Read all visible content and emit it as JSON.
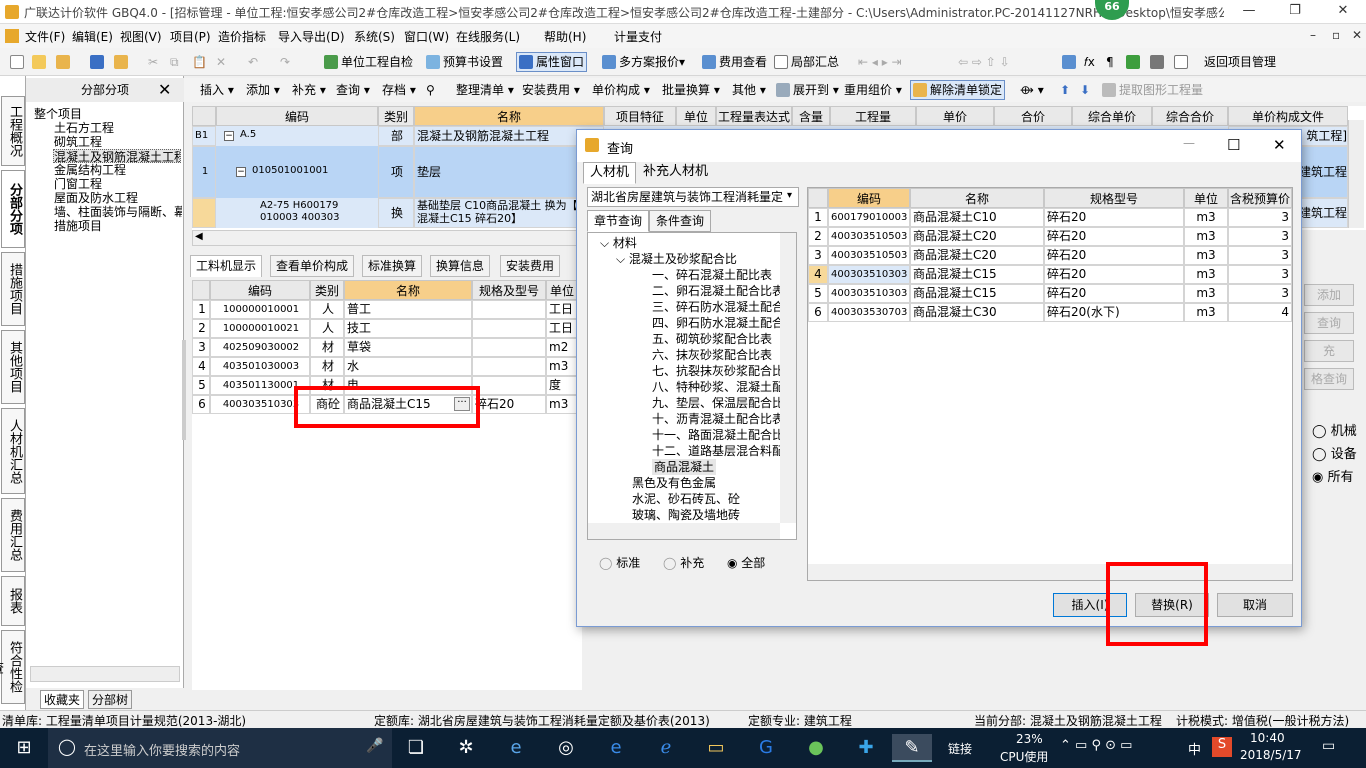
{
  "titlebar": {
    "title": "广联达计价软件 GBQ4.0 - [招标管理 - 单位工程:恒安孝感公司2#仓库改造工程>恒安孝感公司2#仓库改造工程>恒安孝感公司2#仓库改造工程-土建部分 - C:\\Users\\Administrator.PC-20141127NRHM\\Desktop\\恒安孝感公...",
    "badge": "66"
  },
  "menu": [
    "文件(F)",
    "编辑(E)",
    "视图(V)",
    "项目(P)",
    "造价指标",
    "导入导出(D)",
    "系统(S)",
    "窗口(W)",
    "在线服务(L)",
    "帮助(H)",
    "计量支付"
  ],
  "toolbar1": {
    "self_check": "单位工程自检",
    "budget_settings": "预算书设置",
    "property_window": "属性窗口",
    "multi_plan": "多方案报价",
    "fee_view": "费用查看",
    "local_summary": "局部汇总",
    "back_to_project": "返回项目管理"
  },
  "lefttabs": [
    "工程概况",
    "分部分项",
    "措施项目",
    "其他项目",
    "人材机汇总",
    "费用汇总",
    "报表",
    "符合性检查"
  ],
  "tree": {
    "header": "分部分项",
    "root": "整个项目",
    "items": [
      "土石方工程",
      "砌筑工程",
      "混凝土及钢筋混凝土工程",
      "金属结构工程",
      "门窗工程",
      "屋面及防水工程",
      "墙、柱面装饰与隔断、幕",
      "措施项目"
    ],
    "bottom_tabs": [
      "收藏夹",
      "分部树"
    ]
  },
  "toolbar2": [
    "插入",
    "添加",
    "补充",
    "查询",
    "存档",
    "整理清单",
    "安装费用",
    "单价构成",
    "批量换算",
    "其他",
    "展开到",
    "重用组价",
    "解除清单锁定",
    "提取图形工程量"
  ],
  "main_table": {
    "headers": [
      "编码",
      "类别",
      "名称",
      "项目特征",
      "单位",
      "工程量表达式",
      "含量",
      "工程量",
      "单价",
      "合价",
      "综合单价",
      "综合合价",
      "单价构成文件"
    ],
    "rows": [
      {
        "num": "B1",
        "code": "A.5",
        "type": "部",
        "name": "混凝土及钢筋混凝土工程",
        "last": "筑工程]"
      },
      {
        "num": "1",
        "code": "010501001001",
        "type": "项",
        "name": "垫层",
        "last": "建筑工程"
      },
      {
        "num": "",
        "code": "A2-75 H600179 010003 400303",
        "type": "换",
        "name": "基础垫层 C10商品混凝土  换为【商品混凝土C15 碎石20】",
        "last": "建筑工程"
      }
    ]
  },
  "subtabs": [
    "工料机显示",
    "查看单价构成",
    "标准换算",
    "换算信息",
    "安装费用"
  ],
  "sub_table": {
    "headers": [
      "编码",
      "类别",
      "名称",
      "规格及型号",
      "单位"
    ],
    "rows": [
      {
        "num": "1",
        "code": "100000010001",
        "type": "人",
        "name": "普工",
        "spec": "",
        "unit": "工日"
      },
      {
        "num": "2",
        "code": "100000010021",
        "type": "人",
        "name": "技工",
        "spec": "",
        "unit": "工日"
      },
      {
        "num": "3",
        "code": "402509030002",
        "type": "材",
        "name": "草袋",
        "spec": "",
        "unit": "m2"
      },
      {
        "num": "4",
        "code": "403501030003",
        "type": "材",
        "name": "水",
        "spec": "",
        "unit": "m3"
      },
      {
        "num": "5",
        "code": "403501130001",
        "type": "材",
        "name": "电",
        "spec": "",
        "unit": "度"
      },
      {
        "num": "6",
        "code": "400303510303",
        "type": "商砼",
        "name": "商品混凝土C15",
        "spec": "碎石20",
        "unit": "m3"
      }
    ]
  },
  "right_buttons": [
    "添加",
    "查询",
    "充",
    "格查询"
  ],
  "right_radios": [
    "机械",
    "设备",
    "所有"
  ],
  "dialog": {
    "title": "查询",
    "tabs": [
      "人材机",
      "补充人材机"
    ],
    "combo": "湖北省房屋建筑与装饰工程消耗量定",
    "subtabs": [
      "章节查询",
      "条件查询"
    ],
    "tree": [
      "材料",
      "混凝土及砂浆配合比",
      "一、碎石混凝土配比表",
      "二、卵石混凝土配合比表",
      "三、碎石防水混凝土配合",
      "四、卵石防水混凝土配合",
      "五、砌筑砂浆配合比表",
      "六、抹灰砂浆配合比表",
      "七、抗裂抹灰砂浆配合比",
      "八、特种砂浆、混凝土配",
      "九、垫层、保温层配合比",
      "十、沥青混凝土配合比表",
      "十一、路面混凝土配合比",
      "十二、道路基层混合料配",
      "商品混凝土",
      "黑色及有色金属",
      "水泥、砂石砖瓦、砼",
      "玻璃、陶瓷及墙地砖"
    ],
    "radios": [
      "标准",
      "补充",
      "全部"
    ],
    "grid_headers": [
      "编码",
      "名称",
      "规格型号",
      "单位",
      "含税预算价"
    ],
    "grid_rows": [
      {
        "num": "1",
        "code": "600179010003",
        "name": "商品混凝土C10",
        "spec": "碎石20",
        "unit": "m3",
        "price": "3"
      },
      {
        "num": "2",
        "code": "400303510503",
        "name": "商品混凝土C20",
        "spec": "碎石20",
        "unit": "m3",
        "price": "3"
      },
      {
        "num": "3",
        "code": "400303510503",
        "name": "商品混凝土C20",
        "spec": "碎石20",
        "unit": "m3",
        "price": "3"
      },
      {
        "num": "4",
        "code": "400303510303",
        "name": "商品混凝土C15",
        "spec": "碎石20",
        "unit": "m3",
        "price": "3"
      },
      {
        "num": "5",
        "code": "400303510303",
        "name": "商品混凝土C15",
        "spec": "碎石20",
        "unit": "m3",
        "price": "3"
      },
      {
        "num": "6",
        "code": "400303530703",
        "name": "商品混凝土C30",
        "spec": "碎石20(水下)",
        "unit": "m3",
        "price": "4"
      }
    ],
    "insert": "插入(I)",
    "replace": "替换(R)",
    "cancel": "取消"
  },
  "statusbar": {
    "list_lib": "清单库:  工程量清单项目计量规范(2013-湖北)",
    "quota_lib": "定额库:  湖北省房屋建筑与装饰工程消耗量定额及基价表(2013)",
    "quota_major": "定额专业:  建筑工程",
    "current": "当前分部:  混凝土及钢筋混凝土工程",
    "tax_mode": "计税模式:  增值税(一般计税方法)"
  },
  "taskbar": {
    "search_placeholder": "在这里输入你要搜索的内容",
    "link": "链接",
    "cpu_percent": "23%",
    "cpu_label": "CPU使用",
    "ime": "中",
    "time": "10:40",
    "date": "2018/5/17"
  },
  "colors": {
    "highlight": "#c8def7",
    "header_orange": "#f7cf8a",
    "red": "#ff0000",
    "selected_row": "#f7d99a"
  }
}
